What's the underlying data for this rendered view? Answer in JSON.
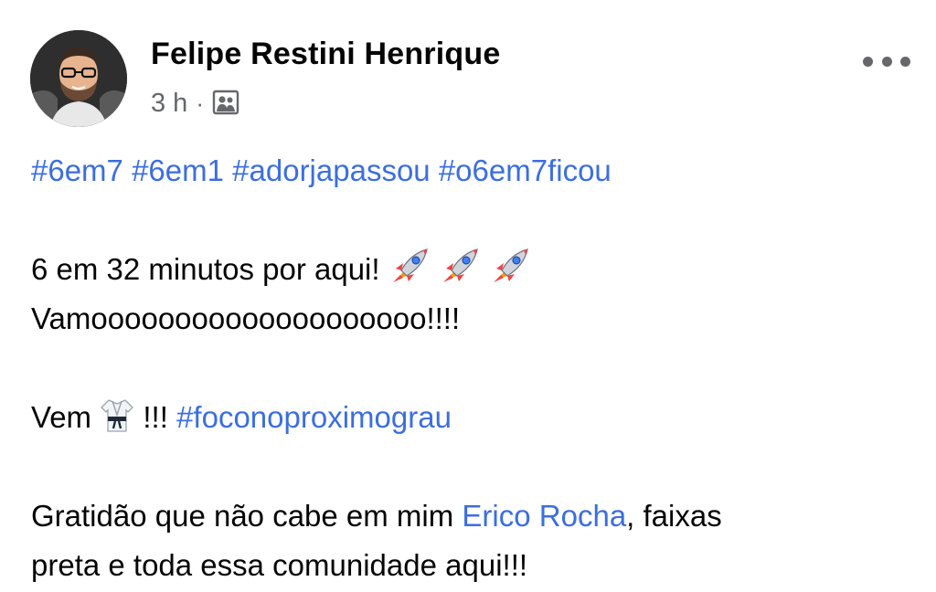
{
  "post": {
    "author": "Felipe Restini Henrique",
    "time": "3 h",
    "separator": "·",
    "audience_icon": "friends-audience-icon",
    "more_icon": "more-options-icon",
    "hashtags_line": [
      "#6em7",
      "#6em1",
      "#adorjapassou",
      "#o6em7ficou"
    ],
    "line2": "6 em 32 minutos por aqui!",
    "line2_emojis": [
      "rocket",
      "rocket",
      "rocket"
    ],
    "line3": "Vamoooooooooooooooooooo!!!!",
    "line4_prefix": "Vem",
    "line4_emoji": "martial-arts-uniform",
    "line4_exclaim": "!!!",
    "line4_hashtag": "#foconoproximograu",
    "line5_prefix": "Gratidão que não cabe em mim",
    "line5_mention": "Erico Rocha",
    "line5_suffix": ", faixas",
    "line6": "preta e toda essa comunidade aqui!!!"
  },
  "colors": {
    "link": "#3b6ee0",
    "meta": "#65676b",
    "text": "#050505"
  }
}
